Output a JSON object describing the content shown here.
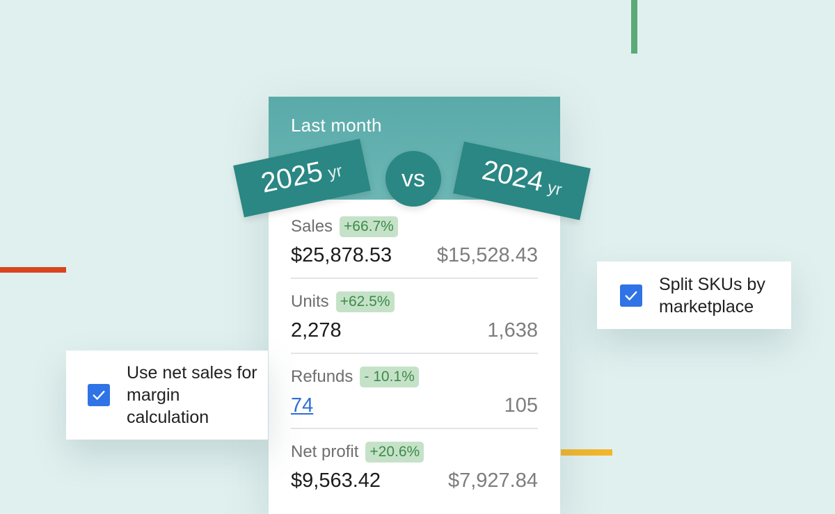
{
  "header": {
    "title": "Last month",
    "current_year": "2025",
    "previous_year": "2024",
    "year_suffix": "yr",
    "vs_label": "vs"
  },
  "metrics": [
    {
      "label": "Sales",
      "change": "+66.7%",
      "current": "$25,878.53",
      "previous": "$15,528.43"
    },
    {
      "label": "Units",
      "change": "+62.5%",
      "current": "2,278",
      "previous": "1,638"
    },
    {
      "label": "Refunds",
      "change": "- 10.1%",
      "current": "74",
      "previous": "105"
    },
    {
      "label": "Net profit",
      "change": "+20.6%",
      "current": "$9,563.42",
      "previous": "$7,927.84"
    }
  ],
  "options": {
    "split_skus": {
      "label": "Split SKUs by marketplace",
      "checked": true
    },
    "net_sales": {
      "label": "Use net sales for margin calculation",
      "checked": true
    }
  },
  "colors": {
    "background": "#e0f0ef",
    "header_teal": "#59aaa9",
    "tag_teal": "#2a8783",
    "badge_green": "#c5e2c8",
    "checkbox_blue": "#2f73e6",
    "accent_green": "#5aaa78",
    "accent_red": "#d9441e",
    "accent_yellow": "#f2b62c"
  }
}
